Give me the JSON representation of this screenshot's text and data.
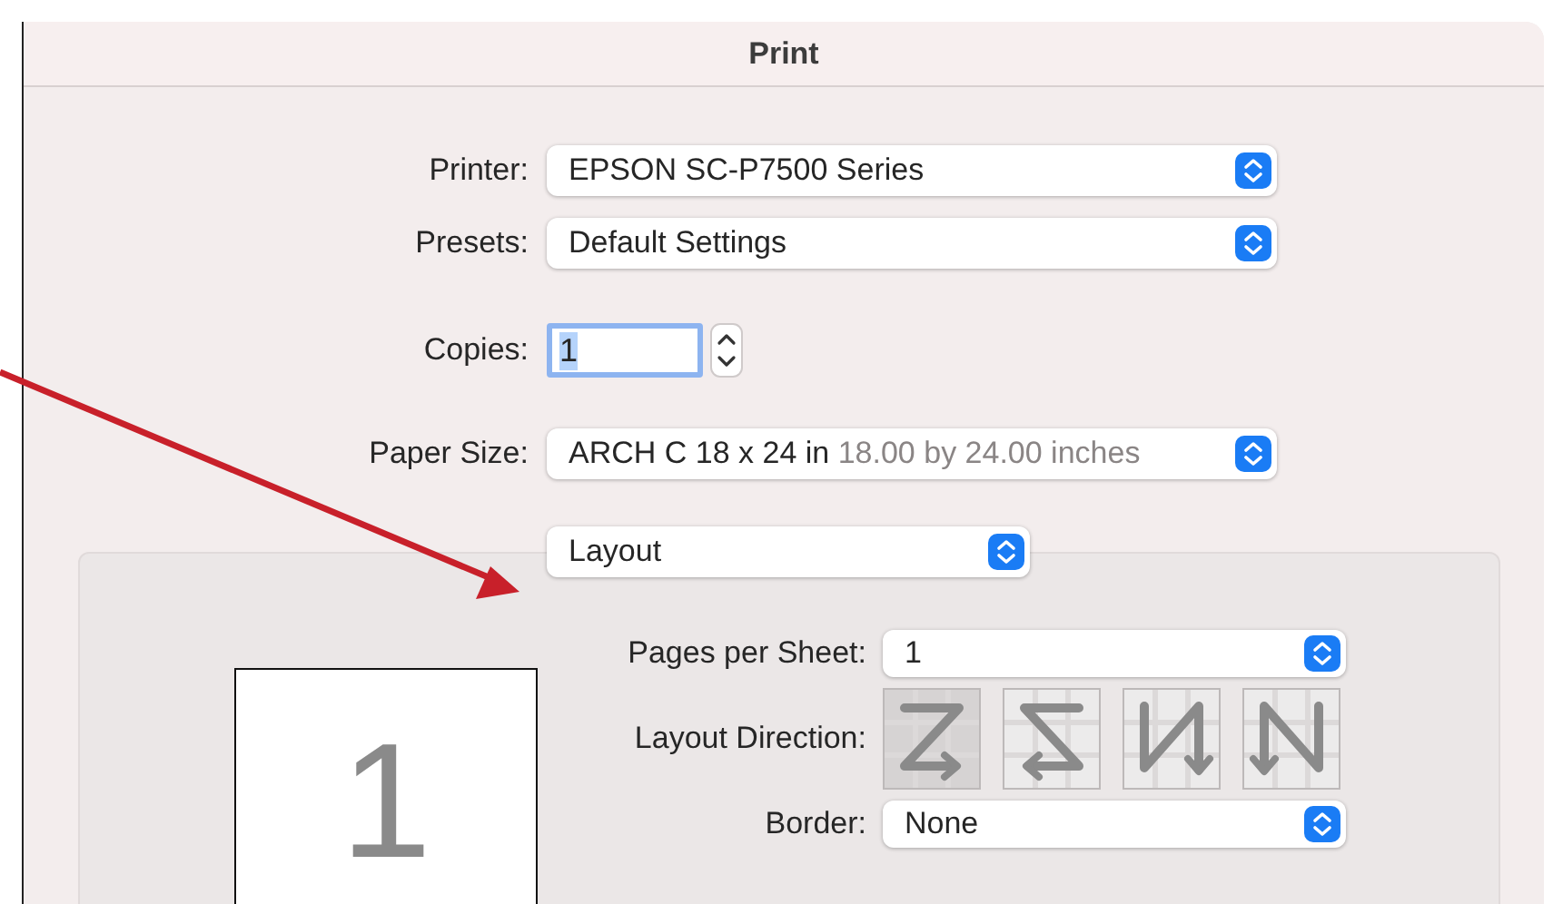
{
  "window": {
    "title": "Print"
  },
  "printer": {
    "label": "Printer:",
    "value": "EPSON SC-P7500 Series"
  },
  "presets": {
    "label": "Presets:",
    "value": "Default Settings"
  },
  "copies": {
    "label": "Copies:",
    "value": "1"
  },
  "paper_size": {
    "label": "Paper Size:",
    "value": "ARCH C 18 x 24 in",
    "detail": "18.00 by 24.00 inches"
  },
  "section_menu": {
    "value": "Layout"
  },
  "layout": {
    "preview_page": "1",
    "pages_per_sheet": {
      "label": "Pages per Sheet:",
      "value": "1"
    },
    "layout_direction": {
      "label": "Layout Direction:",
      "options": [
        {
          "kind": "z",
          "selected": true
        },
        {
          "kind": "s",
          "selected": false
        },
        {
          "kind": "u",
          "selected": false
        },
        {
          "kind": "n",
          "selected": false
        }
      ]
    },
    "border": {
      "label": "Border:",
      "value": "None"
    }
  }
}
